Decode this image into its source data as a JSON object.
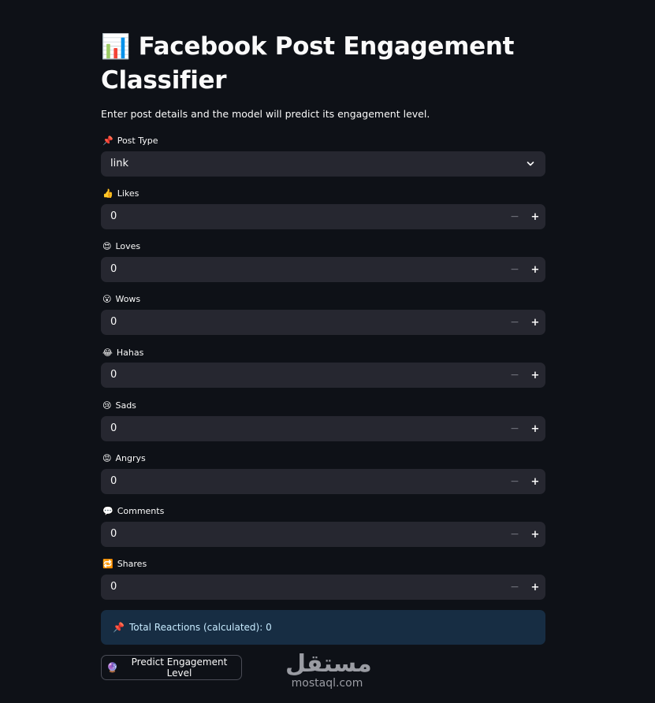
{
  "header": {
    "title_icon": "📊",
    "title": "Facebook Post Engagement Classifier",
    "subtitle": "Enter post details and the model will predict its engagement level."
  },
  "post_type": {
    "icon": "📌",
    "label": "Post Type",
    "value": "link"
  },
  "fields": [
    {
      "icon": "👍",
      "label": "Likes",
      "value": "0",
      "minus": "−",
      "plus": "+"
    },
    {
      "icon": "😍",
      "label": "Loves",
      "value": "0",
      "minus": "−",
      "plus": "+"
    },
    {
      "icon": "😮",
      "label": "Wows",
      "value": "0",
      "minus": "−",
      "plus": "+"
    },
    {
      "icon": "😂",
      "label": "Hahas",
      "value": "0",
      "minus": "−",
      "plus": "+"
    },
    {
      "icon": "😢",
      "label": "Sads",
      "value": "0",
      "minus": "−",
      "plus": "+"
    },
    {
      "icon": "😡",
      "label": "Angrys",
      "value": "0",
      "minus": "−",
      "plus": "+"
    },
    {
      "icon": "💬",
      "label": "Comments",
      "value": "0",
      "minus": "−",
      "plus": "+"
    },
    {
      "icon": "🔁",
      "label": "Shares",
      "value": "0",
      "minus": "−",
      "plus": "+"
    }
  ],
  "total": {
    "icon": "📌",
    "text": "Total Reactions (calculated): 0"
  },
  "predict_button": {
    "icon": "🔮",
    "label": "Predict Engagement Level"
  },
  "watermark": {
    "arabic": "مستقل",
    "latin": "mostaql.com"
  }
}
